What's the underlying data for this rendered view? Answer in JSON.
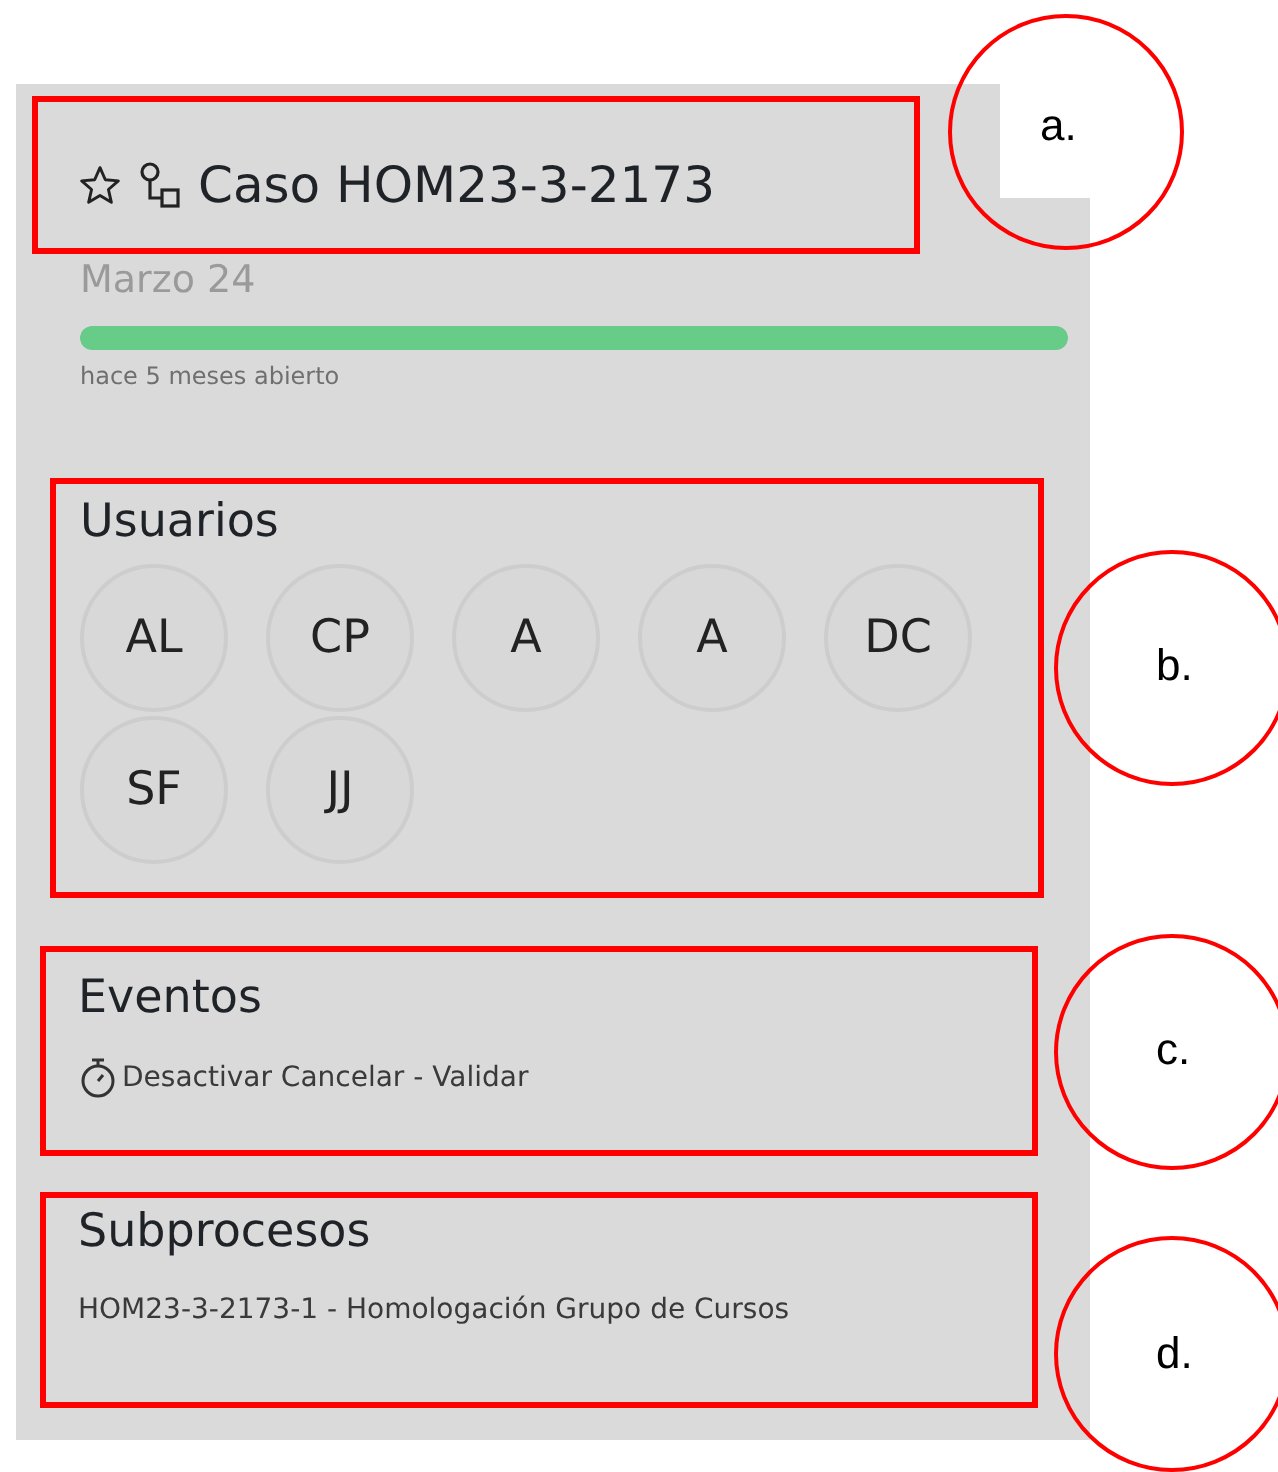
{
  "case": {
    "starred": false,
    "title": "Caso HOM23-3-2173",
    "date": "Marzo 24",
    "progress": {
      "level": 1
    },
    "age": "hace 5 meses abierto"
  },
  "users": {
    "heading": "Usuarios",
    "items": [
      {
        "initials": "AL"
      },
      {
        "initials": "CP"
      },
      {
        "initials": "A"
      },
      {
        "initials": "A"
      },
      {
        "initials": "DC"
      },
      {
        "initials": "SF"
      },
      {
        "initials": "JJ"
      }
    ]
  },
  "events": {
    "heading": "Eventos",
    "items": [
      {
        "text": "Desactivar Cancelar - Validar"
      }
    ]
  },
  "subprocesses": {
    "heading": "Subprocesos",
    "items": [
      {
        "text": "HOM23-3-2173-1 - Homologación Grupo de Cursos"
      }
    ]
  },
  "annotations": [
    {
      "label": "a."
    },
    {
      "label": "b."
    },
    {
      "label": "c."
    },
    {
      "label": "d."
    }
  ]
}
